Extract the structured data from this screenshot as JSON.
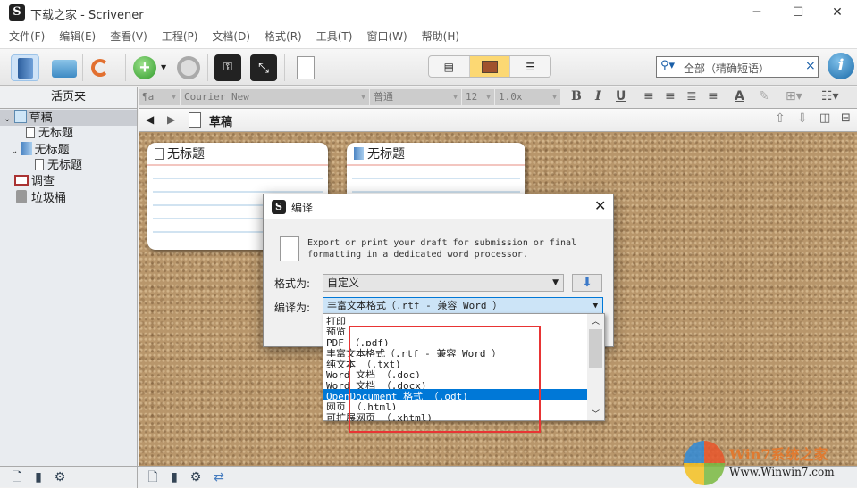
{
  "window": {
    "title": "下载之家 - Scrivener",
    "app_icon": "S",
    "controls": [
      "─",
      "☐",
      "✕"
    ]
  },
  "menu": [
    "文件(F)",
    "编辑(E)",
    "查看(V)",
    "工程(P)",
    "文档(D)",
    "格式(R)",
    "工具(T)",
    "窗口(W)",
    "帮助(H)"
  ],
  "toolbar": {
    "search_placeholder": "全部（精确短语）",
    "search_clear": "×",
    "info": "i"
  },
  "binder": {
    "header": "活页夹",
    "items": [
      {
        "label": "草稿",
        "level": 0,
        "expanded": true,
        "selected": true
      },
      {
        "label": "无标题",
        "level": 1
      },
      {
        "label": "无标题",
        "level": 1,
        "expanded": true
      },
      {
        "label": "无标题",
        "level": 2
      },
      {
        "label": "调查",
        "level": 0
      },
      {
        "label": "垃圾桶",
        "level": 0
      }
    ]
  },
  "format_bar": {
    "style": "¶a",
    "font": "Courier New",
    "weight": "普通",
    "size": "12",
    "spacing": "1.0x",
    "bold": "B",
    "italic": "I",
    "underline": "U"
  },
  "editor": {
    "title": "草稿",
    "cards": [
      "无标题",
      "无标题"
    ]
  },
  "dialog": {
    "title": "编译",
    "description": "Export or print your draft for submission or final formatting in a dedicated word processor.",
    "format_label": "格式为:",
    "format_value": "自定义",
    "compile_label": "编译为:",
    "compile_value": "丰富文本格式（.rtf - 兼容 Word ）",
    "options": [
      "打印",
      "预览",
      "PDF （.pdf)",
      "丰富文本格式（.rtf - 兼容 Word ）",
      "纯文本 （.txt)",
      "Word 文档 （.doc)",
      "Word 文档 （.docx)",
      "OpenDocument 格式 （.odt)",
      "网页 （.html)",
      "可扩展网页 （.xhtml)"
    ],
    "selected_option": "OpenDocument 格式 （.odt)"
  },
  "watermark": {
    "brand": "Win7系统之家",
    "url": "Www.Winwin7.com"
  },
  "colors": {
    "accent": "#0078d7",
    "annotation": "#e83434"
  }
}
